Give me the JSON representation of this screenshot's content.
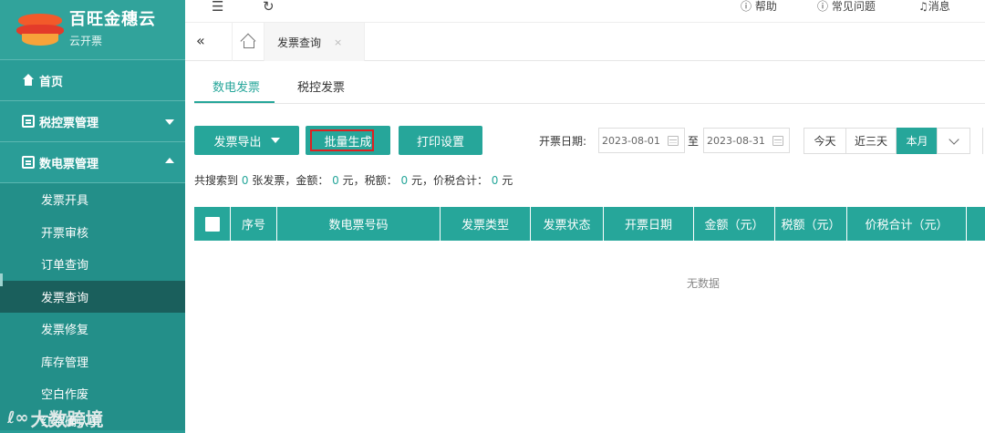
{
  "brand": {
    "title": "百旺金穗云",
    "subtitle": "云开票"
  },
  "sidebar": {
    "items": [
      {
        "label": "首页"
      },
      {
        "label": "税控票管理"
      },
      {
        "label": "数电票管理"
      }
    ],
    "submenu": [
      "发票开具",
      "开票审核",
      "订单查询",
      "发票查询",
      "发票修复",
      "库存管理",
      "空白作废",
      "红字确认单"
    ]
  },
  "watermark": "大数跨境",
  "topbar": {
    "help": "帮助",
    "faq": "常见问题",
    "messages": "消息"
  },
  "tabstrip": {
    "active_tab": "发票查询",
    "close_glyph": "×"
  },
  "inner_tabs": [
    "数电发票",
    "税控发票"
  ],
  "toolbar": {
    "export_label": "发票导出",
    "batch_label": "批量生成",
    "print_label": "打印设置",
    "date_label": "开票日期:",
    "date_from": "2023-08-01",
    "date_to_sep": "至",
    "date_to": "2023-08-31",
    "quick_today": "今天",
    "quick_3days": "近三天",
    "quick_month": "本月"
  },
  "summary": {
    "p1": "共搜索到",
    "count": "0",
    "p2": "张发票，金额：",
    "amount": "0",
    "p3": "元，税额：",
    "tax": "0",
    "p4": "元，价税合计：",
    "total": "0",
    "p5": "元"
  },
  "table": {
    "columns": [
      "序号",
      "数电票号码",
      "发票类型",
      "发票状态",
      "开票日期",
      "金额（元）",
      "税额（元）",
      "价税合计（元）"
    ],
    "empty_text": "无数据"
  },
  "colors": {
    "accent": "#26a69a",
    "sidebar": "#2a9d97",
    "active_menu": "#1a5f5c",
    "highlight": "#e02020"
  }
}
